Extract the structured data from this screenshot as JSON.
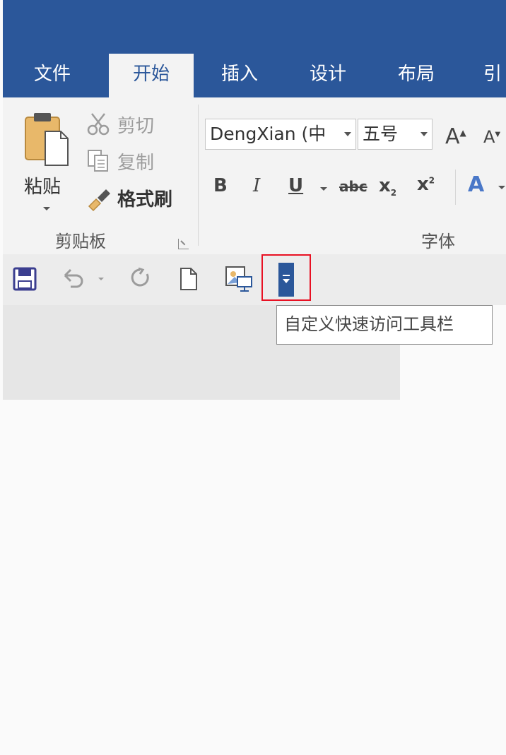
{
  "tabs": [
    {
      "label": "文件",
      "active": false
    },
    {
      "label": "开始",
      "active": true
    },
    {
      "label": "插入",
      "active": false
    },
    {
      "label": "设计",
      "active": false
    },
    {
      "label": "布局",
      "active": false
    },
    {
      "label": "引",
      "active": false
    }
  ],
  "clipboard": {
    "paste_label": "粘贴",
    "cut_label": "剪切",
    "copy_label": "复制",
    "format_painter_label": "格式刷",
    "group_label": "剪贴板"
  },
  "font": {
    "font_name": "DengXian (中",
    "font_size": "五号",
    "grow_label": "A",
    "shrink_label": "A",
    "bold_label": "B",
    "italic_label": "I",
    "underline_label": "U",
    "strikethrough_label": "abc",
    "subscript_label": "x",
    "superscript_label": "x",
    "text_effects_label": "A",
    "group_label": "字体"
  },
  "tooltip": {
    "text": "自定义快速访问工具栏"
  },
  "colors": {
    "brand": "#2b579a",
    "highlight": "#e81123",
    "qat_save": "#3b3e8f"
  },
  "icons": [
    "save-icon",
    "undo-icon",
    "redo-icon",
    "new-document-icon",
    "presentation-icon",
    "customize-dropdown-icon",
    "scissors-icon",
    "copy-icon",
    "format-painter-icon",
    "clipboard-icon"
  ]
}
